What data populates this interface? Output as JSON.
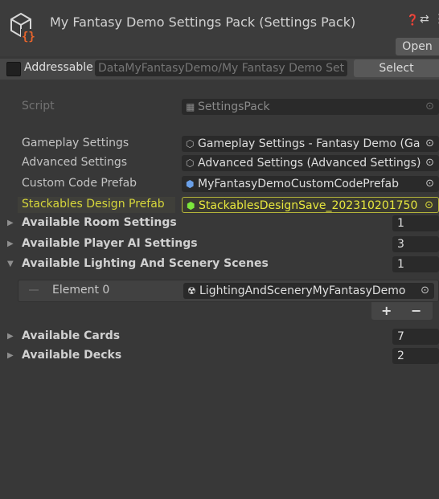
{
  "header": {
    "title": "My Fantasy Demo Settings Pack (Settings Pack)",
    "open_label": "Open",
    "icon": "scriptable-object-icon"
  },
  "addressable": {
    "label": "Addressable",
    "address": "DataMyFantasyDemo/My Fantasy Demo Set",
    "select_label": "Select",
    "checked": false
  },
  "fields": {
    "script": {
      "label": "Script",
      "value": "SettingsPack"
    },
    "gameplay": {
      "label": "Gameplay Settings",
      "value": "Gameplay Settings - Fantasy Demo (Ga"
    },
    "advanced": {
      "label": "Advanced Settings",
      "value": "Advanced Settings (Advanced Settings)"
    },
    "custom_code": {
      "label": "Custom Code Prefab",
      "value": "MyFantasyDemoCustomCodePrefab"
    },
    "stackables": {
      "label": "Stackables Design Prefab",
      "value": "StackablesDesignSave_202310201750"
    }
  },
  "foldouts": {
    "room": {
      "label": "Available Room Settings",
      "count": "1"
    },
    "player_ai": {
      "label": "Available Player AI Settings",
      "count": "3"
    },
    "lighting": {
      "label": "Available Lighting And Scenery Scenes",
      "count": "1",
      "element_label": "Element 0",
      "element_value": "LightingAndSceneryMyFantasyDemo"
    },
    "cards": {
      "label": "Available Cards",
      "count": "7"
    },
    "decks": {
      "label": "Available Decks",
      "count": "2"
    }
  },
  "list_controls": {
    "plus": "+",
    "minus": "−"
  },
  "colors": {
    "background": "#383838",
    "highlight_yellow": "#d6d63a",
    "field_bg": "#2a2a2a"
  }
}
